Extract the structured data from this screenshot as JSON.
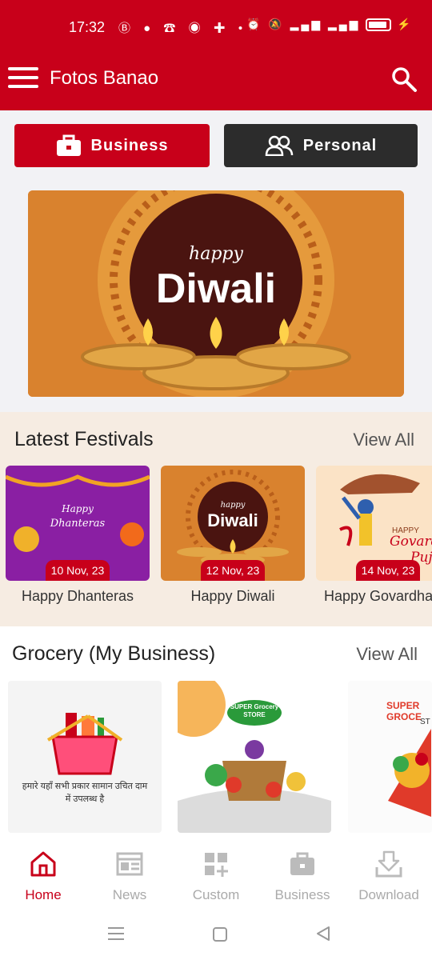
{
  "status": {
    "time": "17:32"
  },
  "app": {
    "title": "Fotos Banao"
  },
  "tabs": [
    {
      "label": "Business"
    },
    {
      "label": "Personal"
    }
  ],
  "hero": {
    "small": "happy",
    "big": "Diwali"
  },
  "latest": {
    "title": "Latest Festivals",
    "view_all": "View All",
    "cards": [
      {
        "label": "Happy Dhanteras",
        "date": "10 Nov, 23",
        "art_small": "Happy",
        "art_big": "Dhanteras"
      },
      {
        "label": "Happy Diwali",
        "date": "12 Nov, 23",
        "art_small": "happy",
        "art_big": "Diwali"
      },
      {
        "label": "Happy Govardhan",
        "date": "14 Nov, 23",
        "art_small": "HAPPY",
        "art_big": "Govardh",
        "art_extra": "Puja"
      }
    ]
  },
  "grocery": {
    "title": "Grocery (My Business)",
    "view_all": "View All",
    "card1_text": "हमारे यहाँ सभी प्रकार सामान उचित दाम में उपलब्ध है",
    "card2_badge": "SUPER Grocery STORE",
    "card3_text": "SUPER GROCE",
    "card3_sub": "ST"
  },
  "nav": [
    {
      "label": "Home",
      "icon": "home-icon"
    },
    {
      "label": "News",
      "icon": "news-icon"
    },
    {
      "label": "Custom",
      "icon": "custom-icon"
    },
    {
      "label": "Business",
      "icon": "briefcase-icon"
    },
    {
      "label": "Download",
      "icon": "download-icon"
    }
  ],
  "colors": {
    "brand": "#c8001a",
    "dark": "#2c2c2c",
    "festival_bg": "#f6ece2"
  }
}
